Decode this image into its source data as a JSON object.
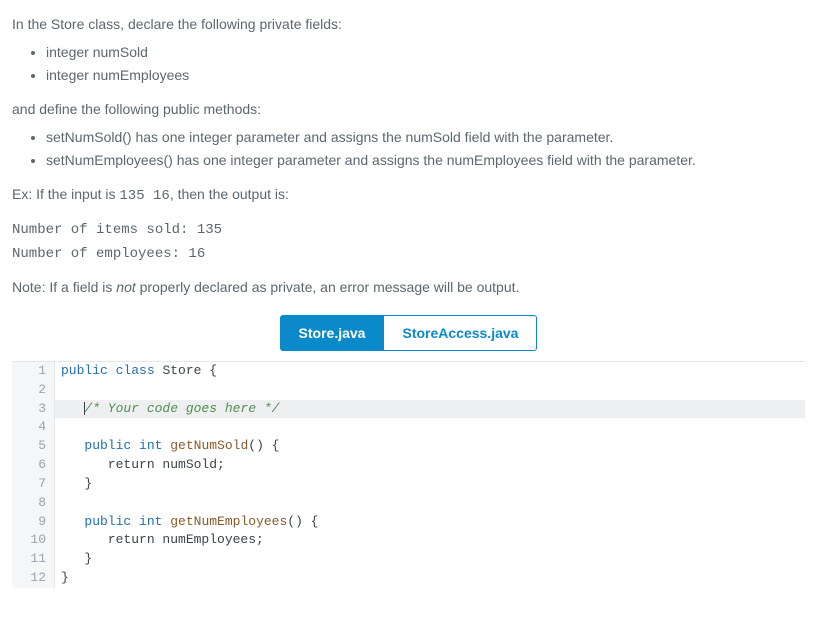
{
  "problem": {
    "intro": "In the Store class, declare the following private fields:",
    "fields": [
      "integer numSold",
      "integer numEmployees"
    ],
    "methodsIntro": "and define the following public methods:",
    "methods": [
      "setNumSold() has one integer parameter and assigns the numSold field with the parameter.",
      "setNumEmployees() has one integer parameter and assigns the numEmployees field with the parameter."
    ],
    "examplePrefix": "Ex: If the input is ",
    "exampleInput": "135 16",
    "exampleSuffix": ", then the output is:",
    "output1": "Number of items sold: 135",
    "output2": "Number of employees: 16",
    "notePrefix": "Note: If a field is ",
    "noteEm": "not",
    "noteSuffix": " properly declared as private, an error message will be output."
  },
  "tabs": {
    "active": "Store.java",
    "inactive": "StoreAccess.java"
  },
  "code": {
    "l1_kw1": "public",
    "l1_kw2": "class",
    "l1_rest": " Store {",
    "l3_cmt": "/* Your code goes here */",
    "l5_pre": "   ",
    "l5_kw1": "public",
    "l5_kw2": "int",
    "l5_fn": "getNumSold",
    "l5_rest": "() {",
    "l6": "      return numSold;",
    "l7": "   }",
    "l9_pre": "   ",
    "l9_kw1": "public",
    "l9_kw2": "int",
    "l9_fn": "getNumEmployees",
    "l9_rest": "() {",
    "l10": "      return numEmployees;",
    "l11": "   }",
    "l12": "}"
  },
  "lineNumbers": [
    "1",
    "2",
    "3",
    "4",
    "5",
    "6",
    "7",
    "8",
    "9",
    "10",
    "11",
    "12"
  ]
}
